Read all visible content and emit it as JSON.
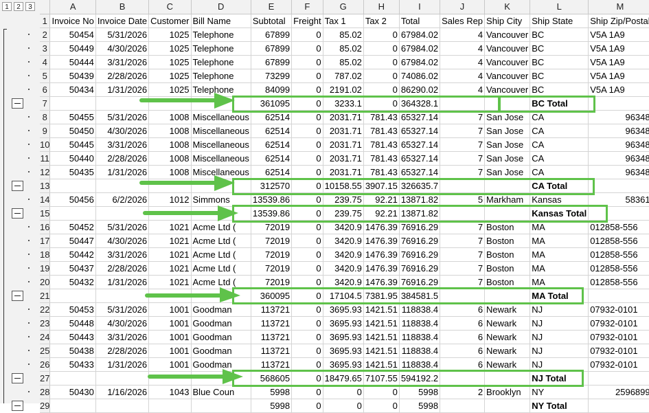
{
  "outline_levels": [
    "1",
    "2",
    "3"
  ],
  "columns": [
    "A",
    "B",
    "C",
    "D",
    "E",
    "F",
    "G",
    "H",
    "I",
    "J",
    "K",
    "L",
    "M"
  ],
  "rows": [
    {
      "num": "1",
      "cells": [
        "Invoice No",
        "Invoice Date",
        "Customer",
        "Bill Name",
        "Subtotal",
        "Freight",
        "Tax 1",
        "Tax 2",
        "Total",
        "Sales Rep",
        "Ship City",
        "Ship State",
        "Ship Zip/Postal"
      ]
    },
    {
      "num": "2",
      "cells": [
        "50454",
        "5/31/2026",
        "1025",
        "Telephone",
        "67899",
        "0",
        "85.02",
        "0",
        "67984.02",
        "4",
        "Vancouver",
        "BC",
        "V5A 1A9"
      ]
    },
    {
      "num": "3",
      "cells": [
        "50449",
        "4/30/2026",
        "1025",
        "Telephone",
        "67899",
        "0",
        "85.02",
        "0",
        "67984.02",
        "4",
        "Vancouver",
        "BC",
        "V5A 1A9"
      ]
    },
    {
      "num": "4",
      "cells": [
        "50444",
        "3/31/2026",
        "1025",
        "Telephone",
        "67899",
        "0",
        "85.02",
        "0",
        "67984.02",
        "4",
        "Vancouver",
        "BC",
        "V5A 1A9"
      ]
    },
    {
      "num": "5",
      "cells": [
        "50439",
        "2/28/2026",
        "1025",
        "Telephone",
        "73299",
        "0",
        "787.02",
        "0",
        "74086.02",
        "4",
        "Vancouver",
        "BC",
        "V5A 1A9"
      ]
    },
    {
      "num": "6",
      "cells": [
        "50434",
        "1/31/2026",
        "1025",
        "Telephone",
        "84099",
        "0",
        "2191.02",
        "0",
        "86290.02",
        "4",
        "Vancouver",
        "BC",
        "V5A 1A9"
      ]
    },
    {
      "num": "7",
      "cells": [
        "",
        "",
        "",
        "",
        "361095",
        "0",
        "3233.1",
        "0",
        "364328.1",
        "",
        "",
        "BC Total",
        ""
      ],
      "total": true
    },
    {
      "num": "8",
      "cells": [
        "50455",
        "5/31/2026",
        "1008",
        "Miscellaneous",
        "62514",
        "0",
        "2031.71",
        "781.43",
        "65327.14",
        "7",
        "San Jose",
        "CA",
        "96348"
      ]
    },
    {
      "num": "9",
      "cells": [
        "50450",
        "4/30/2026",
        "1008",
        "Miscellaneous",
        "62514",
        "0",
        "2031.71",
        "781.43",
        "65327.14",
        "7",
        "San Jose",
        "CA",
        "96348"
      ]
    },
    {
      "num": "10",
      "cells": [
        "50445",
        "3/31/2026",
        "1008",
        "Miscellaneous",
        "62514",
        "0",
        "2031.71",
        "781.43",
        "65327.14",
        "7",
        "San Jose",
        "CA",
        "96348"
      ]
    },
    {
      "num": "11",
      "cells": [
        "50440",
        "2/28/2026",
        "1008",
        "Miscellaneous",
        "62514",
        "0",
        "2031.71",
        "781.43",
        "65327.14",
        "7",
        "San Jose",
        "CA",
        "96348"
      ]
    },
    {
      "num": "12",
      "cells": [
        "50435",
        "1/31/2026",
        "1008",
        "Miscellaneous",
        "62514",
        "0",
        "2031.71",
        "781.43",
        "65327.14",
        "7",
        "San Jose",
        "CA",
        "96348"
      ]
    },
    {
      "num": "13",
      "cells": [
        "",
        "",
        "",
        "",
        "312570",
        "0",
        "10158.55",
        "3907.15",
        "326635.7",
        "",
        "",
        "CA Total",
        ""
      ],
      "total": true
    },
    {
      "num": "14",
      "cells": [
        "50456",
        "6/2/2026",
        "1012",
        "Simmons",
        "13539.86",
        "0",
        "239.75",
        "92.21",
        "13871.82",
        "5",
        "Markham",
        "Kansas",
        "58361"
      ]
    },
    {
      "num": "15",
      "cells": [
        "",
        "",
        "",
        "",
        "13539.86",
        "0",
        "239.75",
        "92.21",
        "13871.82",
        "",
        "",
        "Kansas Total",
        ""
      ],
      "total": true
    },
    {
      "num": "16",
      "cells": [
        "50452",
        "5/31/2026",
        "1021",
        "Acme Ltd (",
        "72019",
        "0",
        "3420.9",
        "1476.39",
        "76916.29",
        "7",
        "Boston",
        "MA",
        "012858-556"
      ]
    },
    {
      "num": "17",
      "cells": [
        "50447",
        "4/30/2026",
        "1021",
        "Acme Ltd (",
        "72019",
        "0",
        "3420.9",
        "1476.39",
        "76916.29",
        "7",
        "Boston",
        "MA",
        "012858-556"
      ]
    },
    {
      "num": "18",
      "cells": [
        "50442",
        "3/31/2026",
        "1021",
        "Acme Ltd (",
        "72019",
        "0",
        "3420.9",
        "1476.39",
        "76916.29",
        "7",
        "Boston",
        "MA",
        "012858-556"
      ]
    },
    {
      "num": "19",
      "cells": [
        "50437",
        "2/28/2026",
        "1021",
        "Acme Ltd (",
        "72019",
        "0",
        "3420.9",
        "1476.39",
        "76916.29",
        "7",
        "Boston",
        "MA",
        "012858-556"
      ]
    },
    {
      "num": "20",
      "cells": [
        "50432",
        "1/31/2026",
        "1021",
        "Acme Ltd (",
        "72019",
        "0",
        "3420.9",
        "1476.39",
        "76916.29",
        "7",
        "Boston",
        "MA",
        "012858-556"
      ]
    },
    {
      "num": "21",
      "cells": [
        "",
        "",
        "",
        "",
        "360095",
        "0",
        "17104.5",
        "7381.95",
        "384581.5",
        "",
        "",
        "MA Total",
        ""
      ],
      "total": true
    },
    {
      "num": "22",
      "cells": [
        "50453",
        "5/31/2026",
        "1001",
        "Goodman",
        "113721",
        "0",
        "3695.93",
        "1421.51",
        "118838.4",
        "6",
        "Newark",
        "NJ",
        "07932-0101"
      ]
    },
    {
      "num": "23",
      "cells": [
        "50448",
        "4/30/2026",
        "1001",
        "Goodman",
        "113721",
        "0",
        "3695.93",
        "1421.51",
        "118838.4",
        "6",
        "Newark",
        "NJ",
        "07932-0101"
      ]
    },
    {
      "num": "24",
      "cells": [
        "50443",
        "3/31/2026",
        "1001",
        "Goodman",
        "113721",
        "0",
        "3695.93",
        "1421.51",
        "118838.4",
        "6",
        "Newark",
        "NJ",
        "07932-0101"
      ]
    },
    {
      "num": "25",
      "cells": [
        "50438",
        "2/28/2026",
        "1001",
        "Goodman",
        "113721",
        "0",
        "3695.93",
        "1421.51",
        "118838.4",
        "6",
        "Newark",
        "NJ",
        "07932-0101"
      ]
    },
    {
      "num": "26",
      "cells": [
        "50433",
        "1/31/2026",
        "1001",
        "Goodman",
        "113721",
        "0",
        "3695.93",
        "1421.51",
        "118838.4",
        "6",
        "Newark",
        "NJ",
        "07932-0101"
      ]
    },
    {
      "num": "27",
      "cells": [
        "",
        "",
        "",
        "",
        "568605",
        "0",
        "18479.65",
        "7107.55",
        "594192.2",
        "",
        "",
        "NJ Total",
        ""
      ],
      "total": true
    },
    {
      "num": "28",
      "cells": [
        "50430",
        "1/16/2026",
        "1043",
        "Blue Coun",
        "5998",
        "0",
        "0",
        "0",
        "5998",
        "2",
        "Brooklyn",
        "NY",
        "2596899"
      ]
    },
    {
      "num": "29",
      "cells": [
        "",
        "",
        "",
        "",
        "5998",
        "0",
        "0",
        "0",
        "5998",
        "",
        "",
        "NY Total",
        ""
      ],
      "total": true
    }
  ],
  "highlight_color": "#5fc24a"
}
